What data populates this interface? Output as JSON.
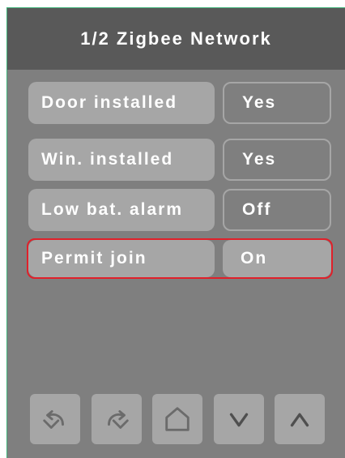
{
  "header": {
    "title": "1/2 Zigbee Network"
  },
  "settings": [
    {
      "label": "Door installed",
      "value": "Yes"
    },
    {
      "label": "Win. installed",
      "value": "Yes"
    },
    {
      "label": "Low bat. alarm",
      "value": "Off"
    },
    {
      "label": "Permit join",
      "value": "On",
      "selected": true
    }
  ],
  "footer": {
    "buttons": [
      {
        "icon": "undo-icon"
      },
      {
        "icon": "redo-icon"
      },
      {
        "icon": "home-icon"
      },
      {
        "icon": "chevron-down-icon"
      },
      {
        "icon": "chevron-up-icon"
      }
    ]
  },
  "colors": {
    "screen_bg": "#7f7f7f",
    "header_bg": "#595959",
    "tile_bg": "#a6a6a6",
    "selection": "#e0202a",
    "text": "#ffffff"
  }
}
